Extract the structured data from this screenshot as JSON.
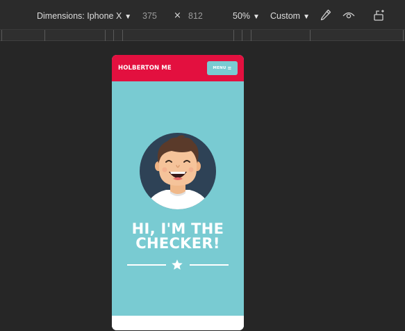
{
  "devtools": {
    "dimensions_label": "Dimensions: Iphone X",
    "width_value": "375",
    "height_value": "812",
    "times_symbol": "×",
    "zoom_label": "50%",
    "throttle_label": "Custom",
    "icons": [
      "eyedropper-icon",
      "eye-icon",
      "rotate-device-icon"
    ]
  },
  "site": {
    "brand": "HOLBERTON ME",
    "menu_label": "MENU",
    "menu_icon": "≡",
    "headline_line1": "HI, I'M THE",
    "headline_line2": "CHECKER!",
    "colors": {
      "navbar": "#e3103f",
      "accent": "#79cbd2",
      "avatar_bg": "#2e4256"
    }
  }
}
